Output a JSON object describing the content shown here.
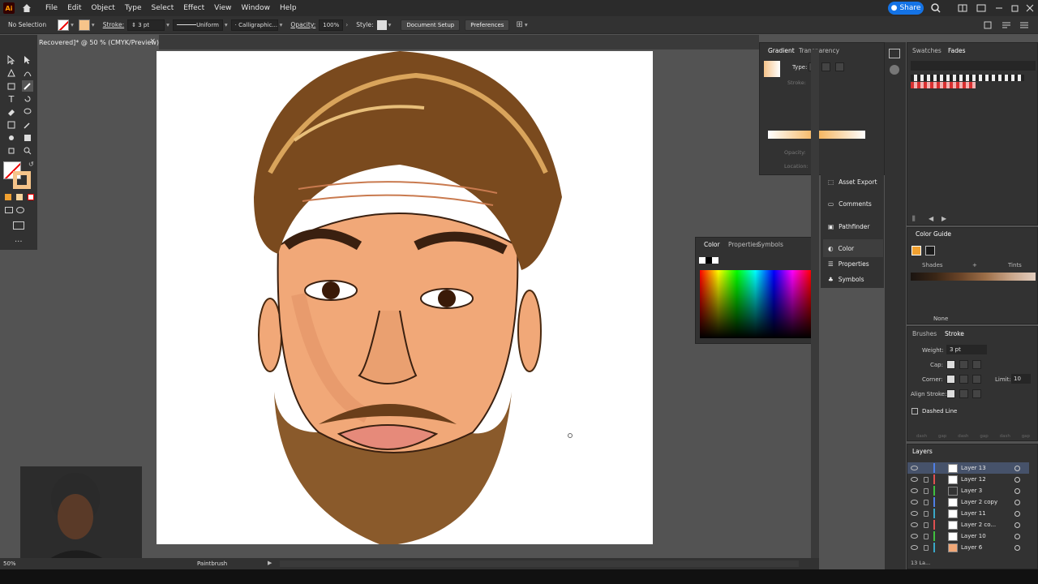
{
  "app": {
    "logo": "Ai"
  },
  "menu": [
    "File",
    "Edit",
    "Object",
    "Type",
    "Select",
    "Effect",
    "View",
    "Window",
    "Help"
  ],
  "share_label": "Share",
  "control": {
    "selection": "No Selection",
    "stroke_label": "Stroke:",
    "stroke_value": "3 pt",
    "profile": "Uniform",
    "brush": "Calligraphic...",
    "opacity_label": "Opacity:",
    "opacity_value": "100%",
    "style_label": "Style:",
    "doc_setup": "Document Setup",
    "preferences": "Preferences"
  },
  "document_tab": {
    "title": "Recovered]* @ 50 % (CMYK/Preview)",
    "close": "×"
  },
  "gradient_panel": {
    "tabs": [
      "Gradient",
      "Transparency"
    ],
    "type_label": "Type:",
    "stroke_label": "Stroke:",
    "opacity_label": "Opacity:",
    "location_label": "Location:"
  },
  "color_panel": {
    "tabs": [
      "Color",
      "Properties",
      "Symbols"
    ]
  },
  "side_panels": [
    "Asset Export",
    "Comments",
    "Pathfinder",
    "Color",
    "Properties",
    "Symbols"
  ],
  "swatches_panel": {
    "tabs": [
      "Swatches",
      "Fades"
    ]
  },
  "color_guide": {
    "title": "Color Guide",
    "shades": "Shades",
    "tints": "Tints",
    "none_label": "None",
    "plus": "+"
  },
  "stroke_panel": {
    "tabs": [
      "Brushes",
      "Stroke"
    ],
    "weight_label": "Weight:",
    "weight_value": "3 pt",
    "cap_label": "Cap:",
    "corner_label": "Corner:",
    "limit_label": "Limit:",
    "limit_value": "10",
    "align_label": "Align Stroke:",
    "dashed_label": "Dashed Line",
    "dash_labels": [
      "dash",
      "gap",
      "dash",
      "gap",
      "dash",
      "gap"
    ]
  },
  "layers_panel": {
    "title": "Layers",
    "layers": [
      {
        "name": "Layer 13",
        "color": "#4f7fe6"
      },
      {
        "name": "Layer 12",
        "color": "#e05050"
      },
      {
        "name": "Layer 3",
        "color": "#40c040"
      },
      {
        "name": "Layer 2 copy",
        "color": "#4f7fe6"
      },
      {
        "name": "Layer 11",
        "color": "#3aa8c8"
      },
      {
        "name": "Layer 2 co...",
        "color": "#e05050"
      },
      {
        "name": "Layer 10",
        "color": "#40c040"
      },
      {
        "name": "Layer 6",
        "color": "#3aa8c8"
      }
    ],
    "count": "13 La..."
  },
  "status": {
    "zoom": "50%",
    "tool": "Paintbrush"
  },
  "colors": {
    "accent": "#1473e6",
    "fill_swatch": "#f6c48a",
    "hair": "#7a4a1e",
    "skin": "#f1a878"
  }
}
